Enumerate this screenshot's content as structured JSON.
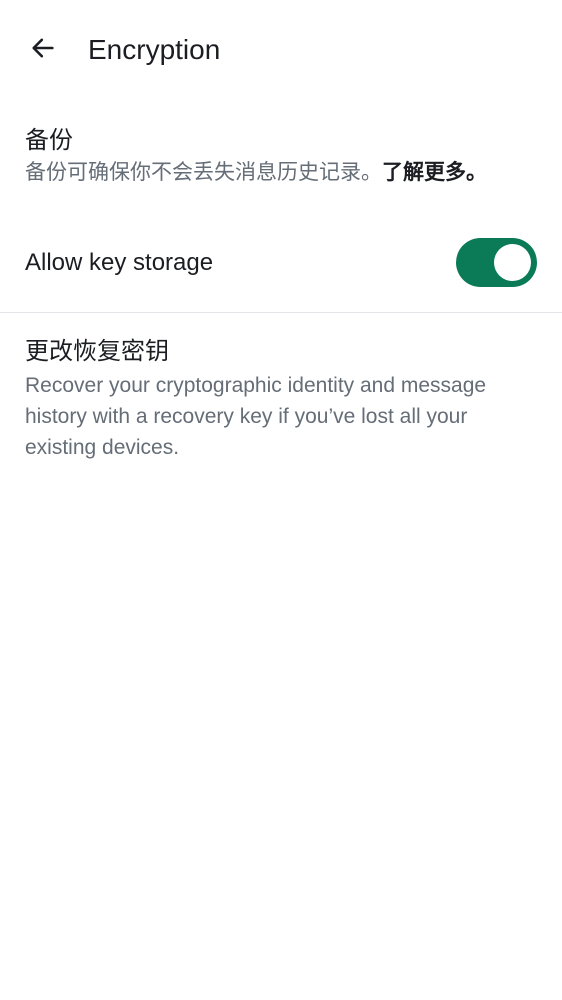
{
  "header": {
    "title": "Encryption",
    "back_icon": "arrow-left-icon"
  },
  "backup": {
    "heading": "备份",
    "description": "备份可确保你不会丢失消息历史记录。",
    "learn_more": "了解更多。"
  },
  "key_storage": {
    "label": "Allow key storage",
    "enabled": true,
    "toggle_color": "#0b7a57"
  },
  "recovery": {
    "heading": "更改恢复密钥",
    "description": "Recover your cryptographic identity and message history with a recovery key if you’ve lost all your existing devices."
  }
}
